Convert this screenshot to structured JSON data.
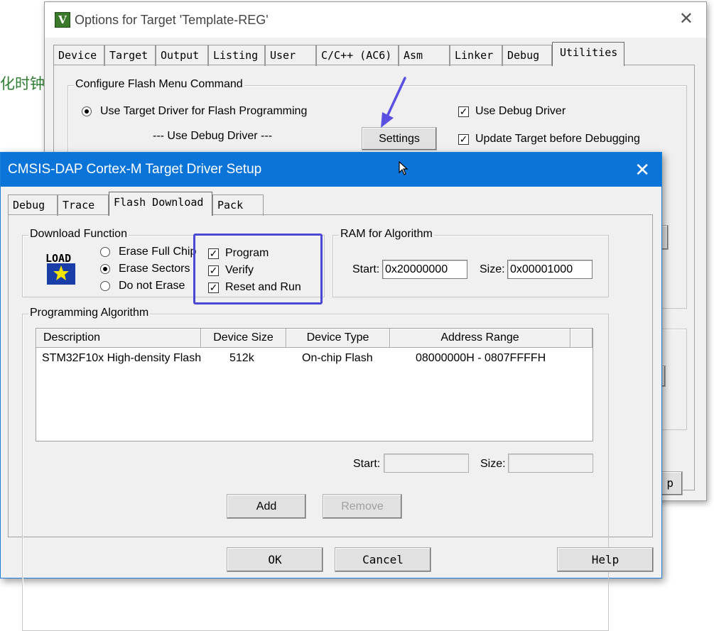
{
  "background": {
    "partial_text": "化时钟"
  },
  "options_window": {
    "title": "Options for Target 'Template-REG'",
    "tabs": [
      "Device",
      "Target",
      "Output",
      "Listing",
      "User",
      "C/C++ (AC6)",
      "Asm",
      "Linker",
      "Debug",
      "Utilities"
    ],
    "active_tab": "Utilities",
    "flash_group_label": "Configure Flash Menu Command",
    "radio_label": "Use Target Driver for Flash Programming",
    "driver_placeholder": "--- Use Debug Driver ---",
    "settings_button": "Settings",
    "use_debug_driver": "Use Debug Driver",
    "update_target": "Update Target before Debugging",
    "partial_button": "p"
  },
  "driver_dialog": {
    "title": "CMSIS-DAP Cortex-M Target Driver Setup",
    "tabs": [
      "Debug",
      "Trace",
      "Flash Download",
      "Pack"
    ],
    "active_tab": "Flash Download",
    "download_function": {
      "label": "Download Function",
      "icon_text": "LOAD",
      "radios": [
        "Erase Full Chip",
        "Erase Sectors",
        "Do not Erase"
      ],
      "selected_radio": "Erase Sectors",
      "checkboxes": [
        "Program",
        "Verify",
        "Reset and Run"
      ]
    },
    "ram": {
      "label": "RAM for Algorithm",
      "start_label": "Start:",
      "start_value": "0x20000000",
      "size_label": "Size:",
      "size_value": "0x00001000"
    },
    "algorithm": {
      "label": "Programming Algorithm",
      "columns": [
        "Description",
        "Device Size",
        "Device Type",
        "Address Range"
      ],
      "rows": [
        [
          "STM32F10x High-density Flash",
          "512k",
          "On-chip Flash",
          "08000000H - 0807FFFFH"
        ]
      ],
      "start_label": "Start:",
      "size_label": "Size:"
    },
    "buttons": {
      "add": "Add",
      "remove": "Remove",
      "ok": "OK",
      "cancel": "Cancel",
      "help": "Help"
    }
  },
  "colors": {
    "title_blue": "#0a74d8",
    "highlight": "#4b47d6",
    "arrow": "#5a4fe0"
  }
}
